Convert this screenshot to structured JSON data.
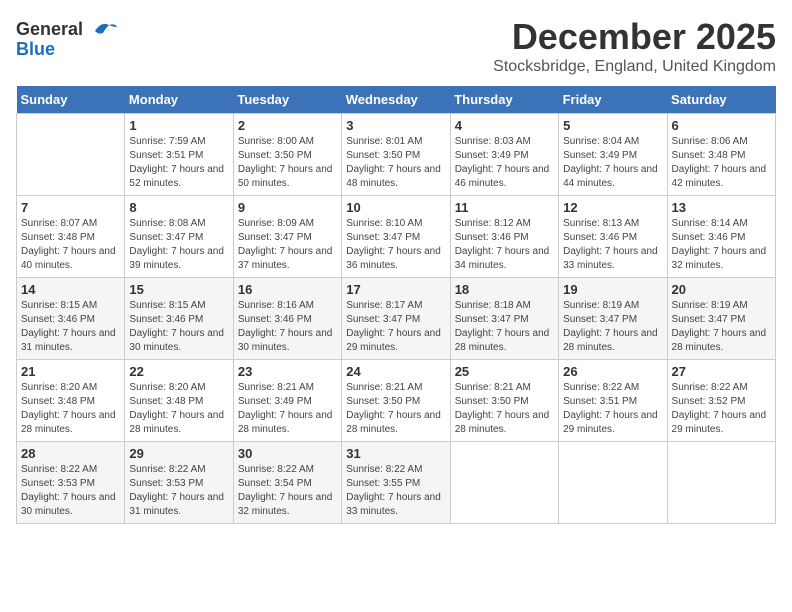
{
  "header": {
    "logo_general": "General",
    "logo_blue": "Blue",
    "title": "December 2025",
    "subtitle": "Stocksbridge, England, United Kingdom"
  },
  "calendar": {
    "weekdays": [
      "Sunday",
      "Monday",
      "Tuesday",
      "Wednesday",
      "Thursday",
      "Friday",
      "Saturday"
    ],
    "weeks": [
      [
        {
          "day": "",
          "sunrise": "",
          "sunset": "",
          "daylight": ""
        },
        {
          "day": "1",
          "sunrise": "Sunrise: 7:59 AM",
          "sunset": "Sunset: 3:51 PM",
          "daylight": "Daylight: 7 hours and 52 minutes."
        },
        {
          "day": "2",
          "sunrise": "Sunrise: 8:00 AM",
          "sunset": "Sunset: 3:50 PM",
          "daylight": "Daylight: 7 hours and 50 minutes."
        },
        {
          "day": "3",
          "sunrise": "Sunrise: 8:01 AM",
          "sunset": "Sunset: 3:50 PM",
          "daylight": "Daylight: 7 hours and 48 minutes."
        },
        {
          "day": "4",
          "sunrise": "Sunrise: 8:03 AM",
          "sunset": "Sunset: 3:49 PM",
          "daylight": "Daylight: 7 hours and 46 minutes."
        },
        {
          "day": "5",
          "sunrise": "Sunrise: 8:04 AM",
          "sunset": "Sunset: 3:49 PM",
          "daylight": "Daylight: 7 hours and 44 minutes."
        },
        {
          "day": "6",
          "sunrise": "Sunrise: 8:06 AM",
          "sunset": "Sunset: 3:48 PM",
          "daylight": "Daylight: 7 hours and 42 minutes."
        }
      ],
      [
        {
          "day": "7",
          "sunrise": "Sunrise: 8:07 AM",
          "sunset": "Sunset: 3:48 PM",
          "daylight": "Daylight: 7 hours and 40 minutes."
        },
        {
          "day": "8",
          "sunrise": "Sunrise: 8:08 AM",
          "sunset": "Sunset: 3:47 PM",
          "daylight": "Daylight: 7 hours and 39 minutes."
        },
        {
          "day": "9",
          "sunrise": "Sunrise: 8:09 AM",
          "sunset": "Sunset: 3:47 PM",
          "daylight": "Daylight: 7 hours and 37 minutes."
        },
        {
          "day": "10",
          "sunrise": "Sunrise: 8:10 AM",
          "sunset": "Sunset: 3:47 PM",
          "daylight": "Daylight: 7 hours and 36 minutes."
        },
        {
          "day": "11",
          "sunrise": "Sunrise: 8:12 AM",
          "sunset": "Sunset: 3:46 PM",
          "daylight": "Daylight: 7 hours and 34 minutes."
        },
        {
          "day": "12",
          "sunrise": "Sunrise: 8:13 AM",
          "sunset": "Sunset: 3:46 PM",
          "daylight": "Daylight: 7 hours and 33 minutes."
        },
        {
          "day": "13",
          "sunrise": "Sunrise: 8:14 AM",
          "sunset": "Sunset: 3:46 PM",
          "daylight": "Daylight: 7 hours and 32 minutes."
        }
      ],
      [
        {
          "day": "14",
          "sunrise": "Sunrise: 8:15 AM",
          "sunset": "Sunset: 3:46 PM",
          "daylight": "Daylight: 7 hours and 31 minutes."
        },
        {
          "day": "15",
          "sunrise": "Sunrise: 8:15 AM",
          "sunset": "Sunset: 3:46 PM",
          "daylight": "Daylight: 7 hours and 30 minutes."
        },
        {
          "day": "16",
          "sunrise": "Sunrise: 8:16 AM",
          "sunset": "Sunset: 3:46 PM",
          "daylight": "Daylight: 7 hours and 30 minutes."
        },
        {
          "day": "17",
          "sunrise": "Sunrise: 8:17 AM",
          "sunset": "Sunset: 3:47 PM",
          "daylight": "Daylight: 7 hours and 29 minutes."
        },
        {
          "day": "18",
          "sunrise": "Sunrise: 8:18 AM",
          "sunset": "Sunset: 3:47 PM",
          "daylight": "Daylight: 7 hours and 28 minutes."
        },
        {
          "day": "19",
          "sunrise": "Sunrise: 8:19 AM",
          "sunset": "Sunset: 3:47 PM",
          "daylight": "Daylight: 7 hours and 28 minutes."
        },
        {
          "day": "20",
          "sunrise": "Sunrise: 8:19 AM",
          "sunset": "Sunset: 3:47 PM",
          "daylight": "Daylight: 7 hours and 28 minutes."
        }
      ],
      [
        {
          "day": "21",
          "sunrise": "Sunrise: 8:20 AM",
          "sunset": "Sunset: 3:48 PM",
          "daylight": "Daylight: 7 hours and 28 minutes."
        },
        {
          "day": "22",
          "sunrise": "Sunrise: 8:20 AM",
          "sunset": "Sunset: 3:48 PM",
          "daylight": "Daylight: 7 hours and 28 minutes."
        },
        {
          "day": "23",
          "sunrise": "Sunrise: 8:21 AM",
          "sunset": "Sunset: 3:49 PM",
          "daylight": "Daylight: 7 hours and 28 minutes."
        },
        {
          "day": "24",
          "sunrise": "Sunrise: 8:21 AM",
          "sunset": "Sunset: 3:50 PM",
          "daylight": "Daylight: 7 hours and 28 minutes."
        },
        {
          "day": "25",
          "sunrise": "Sunrise: 8:21 AM",
          "sunset": "Sunset: 3:50 PM",
          "daylight": "Daylight: 7 hours and 28 minutes."
        },
        {
          "day": "26",
          "sunrise": "Sunrise: 8:22 AM",
          "sunset": "Sunset: 3:51 PM",
          "daylight": "Daylight: 7 hours and 29 minutes."
        },
        {
          "day": "27",
          "sunrise": "Sunrise: 8:22 AM",
          "sunset": "Sunset: 3:52 PM",
          "daylight": "Daylight: 7 hours and 29 minutes."
        }
      ],
      [
        {
          "day": "28",
          "sunrise": "Sunrise: 8:22 AM",
          "sunset": "Sunset: 3:53 PM",
          "daylight": "Daylight: 7 hours and 30 minutes."
        },
        {
          "day": "29",
          "sunrise": "Sunrise: 8:22 AM",
          "sunset": "Sunset: 3:53 PM",
          "daylight": "Daylight: 7 hours and 31 minutes."
        },
        {
          "day": "30",
          "sunrise": "Sunrise: 8:22 AM",
          "sunset": "Sunset: 3:54 PM",
          "daylight": "Daylight: 7 hours and 32 minutes."
        },
        {
          "day": "31",
          "sunrise": "Sunrise: 8:22 AM",
          "sunset": "Sunset: 3:55 PM",
          "daylight": "Daylight: 7 hours and 33 minutes."
        },
        {
          "day": "",
          "sunrise": "",
          "sunset": "",
          "daylight": ""
        },
        {
          "day": "",
          "sunrise": "",
          "sunset": "",
          "daylight": ""
        },
        {
          "day": "",
          "sunrise": "",
          "sunset": "",
          "daylight": ""
        }
      ]
    ]
  }
}
